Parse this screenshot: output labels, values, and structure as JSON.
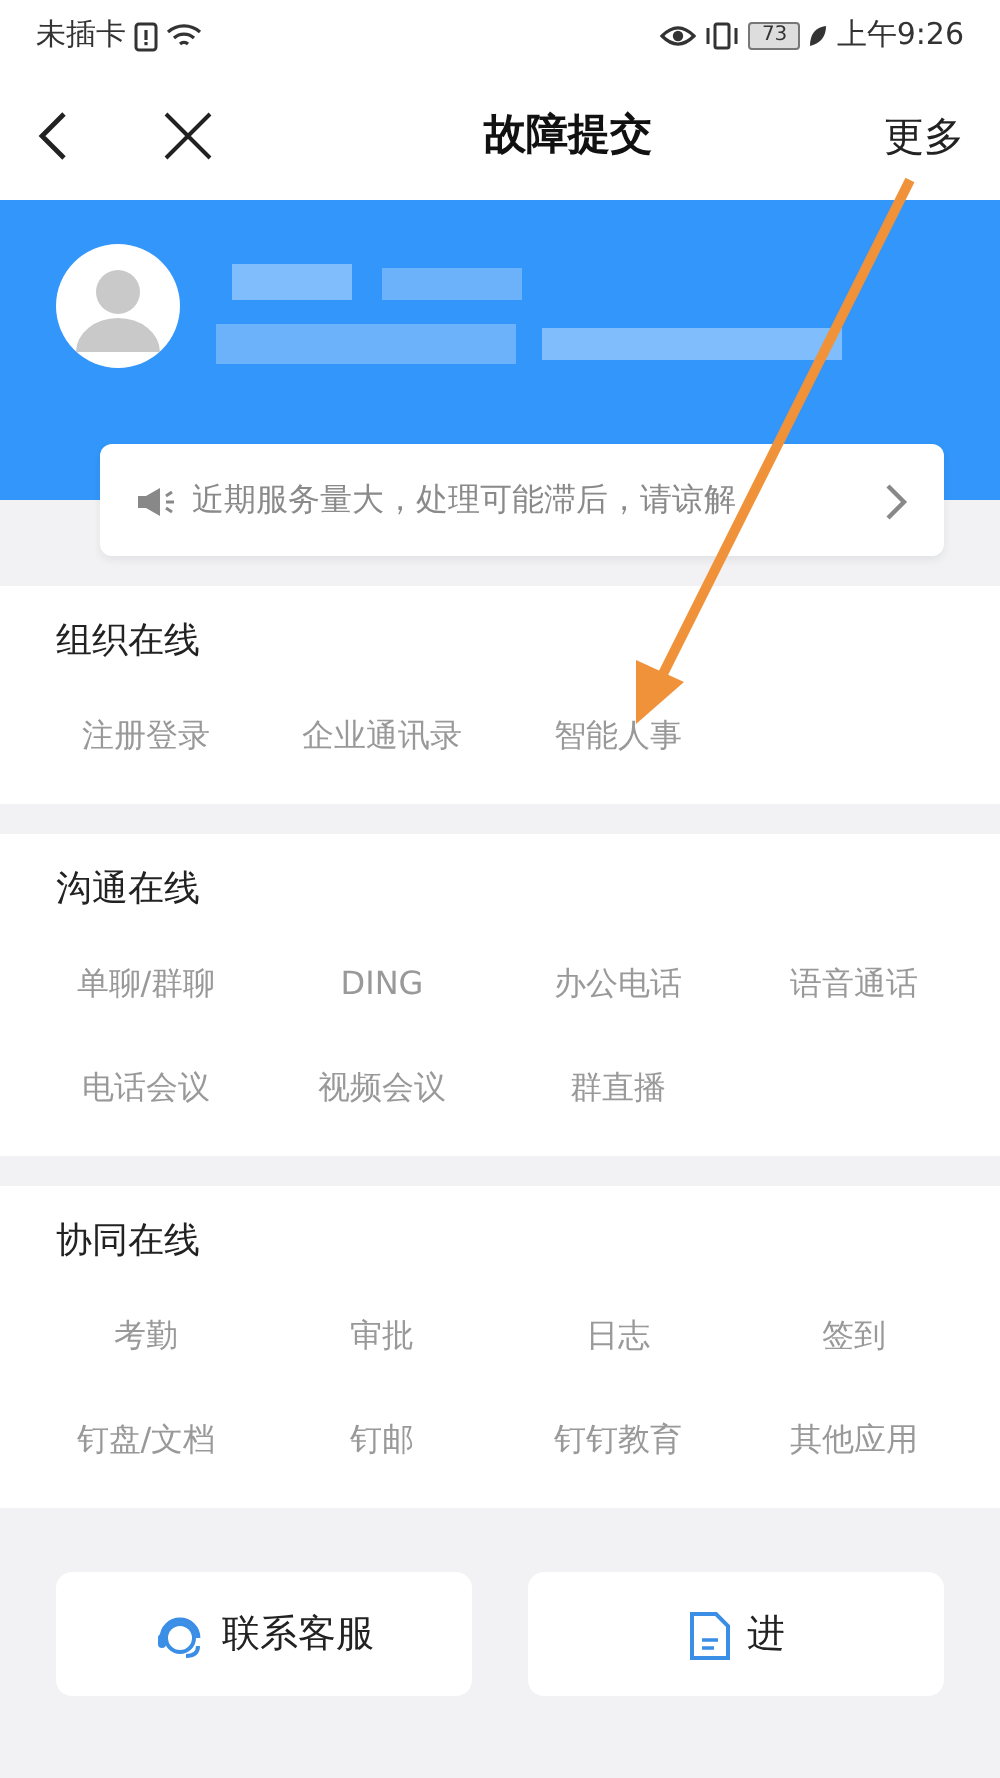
{
  "status_bar": {
    "carrier": "未插卡",
    "battery": "73",
    "time": "上午9:26"
  },
  "header": {
    "title": "故障提交",
    "more": "更多"
  },
  "notice": {
    "text": "近期服务量大，处理可能滞后，请谅解"
  },
  "sections": [
    {
      "title": "组织在线",
      "items": [
        "注册登录",
        "企业通讯录",
        "智能人事"
      ]
    },
    {
      "title": "沟通在线",
      "items": [
        "单聊/群聊",
        "DING",
        "办公电话",
        "语音通话",
        "电话会议",
        "视频会议",
        "群直播"
      ]
    },
    {
      "title": "协同在线",
      "items": [
        "考勤",
        "审批",
        "日志",
        "签到",
        "钉盘/文档",
        "钉邮",
        "钉钉教育",
        "其他应用"
      ]
    }
  ],
  "buttons": [
    {
      "kind": "service",
      "label": "联系客服"
    },
    {
      "kind": "document",
      "label": "进"
    }
  ]
}
